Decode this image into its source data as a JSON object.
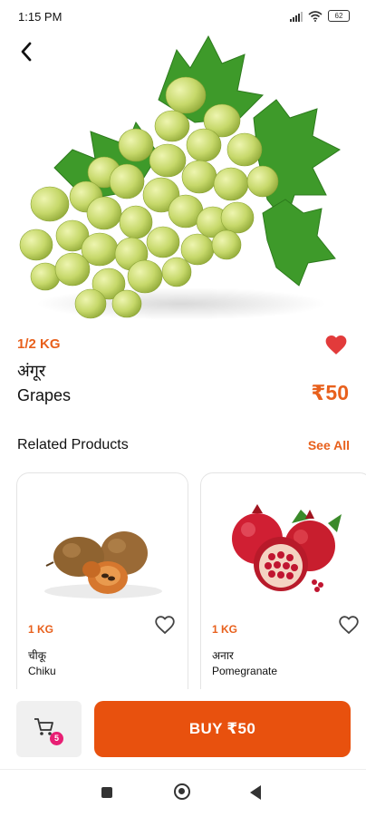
{
  "status_bar": {
    "time": "1:15 PM",
    "battery": "62"
  },
  "product": {
    "weight": "1/2 KG",
    "name_hindi": "अंगूर",
    "name": "Grapes",
    "price": "₹50"
  },
  "related": {
    "heading": "Related Products",
    "see_all": "See All",
    "items": [
      {
        "weight": "1 KG",
        "name_hindi": "चीकू",
        "name": "Chiku"
      },
      {
        "weight": "1 KG",
        "name_hindi": "अनार",
        "name": "Pomegranate"
      }
    ]
  },
  "cart": {
    "count": "5"
  },
  "buy_button": {
    "label": "BUY ₹50"
  },
  "colors": {
    "accent": "#e8601c",
    "buy": "#e8510e",
    "heart": "#e23b3b",
    "badge": "#e81f74"
  },
  "icons": [
    "back-arrow-icon",
    "heart-filled-icon",
    "heart-outline-icon",
    "cart-icon",
    "signal-icon",
    "wifi-icon",
    "battery-icon"
  ]
}
